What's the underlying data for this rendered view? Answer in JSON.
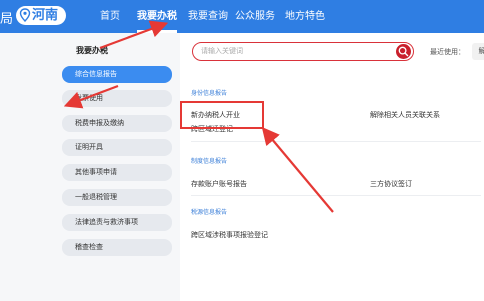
{
  "header": {
    "brand_fragment": "局",
    "region": "河南",
    "nav": [
      "首页",
      "我要办税",
      "我要查询",
      "公众服务",
      "地方特色"
    ],
    "active_nav": "我要办税"
  },
  "sidebar": {
    "title": "我要办税",
    "items": [
      {
        "label": "综合信息报告",
        "active": true
      },
      {
        "label": "发票使用"
      },
      {
        "label": "税费申报及缴纳"
      },
      {
        "label": "证明开具"
      },
      {
        "label": "其他事项申请"
      },
      {
        "label": "一般退税管理"
      },
      {
        "label": "法律追责与救济事项"
      },
      {
        "label": "稽查检查"
      }
    ]
  },
  "main": {
    "search_placeholder": "请输入关键词",
    "recent_label": "最近使用：",
    "recent_chip": "解",
    "sections": [
      {
        "title": "身份信息报告",
        "items": [
          "新办纳税人开业",
          "解除相关人员关联关系",
          "跨区域迁登记"
        ]
      },
      {
        "title": "制度信息报告",
        "items": [
          "存款账户账号报告",
          "三方协议签订"
        ]
      },
      {
        "title": "税源信息报告",
        "items": [
          "跨区域涉税事项报验登记"
        ]
      }
    ]
  },
  "colors": {
    "header_bg": "#2f7ee3",
    "sidebar_active": "#3b8cf0",
    "annotation_red": "#e53935"
  }
}
